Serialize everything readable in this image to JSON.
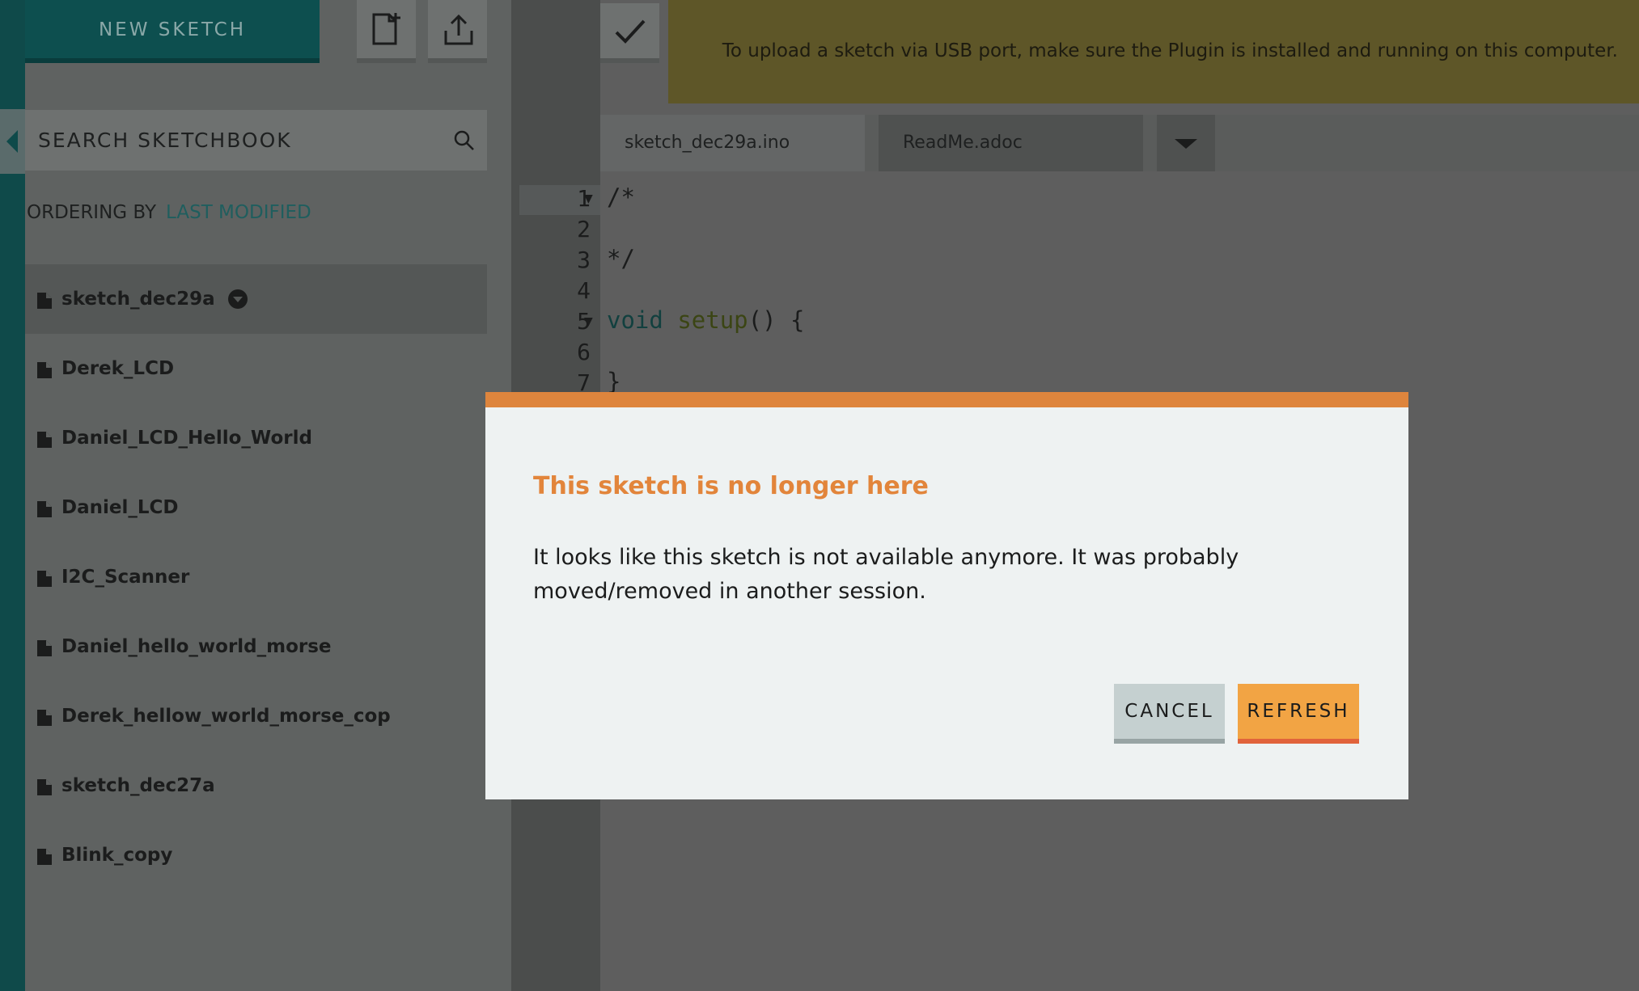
{
  "sidebar": {
    "new_sketch_label": "NEW SKETCH",
    "search_placeholder": "SEARCH SKETCHBOOK",
    "ordering_label": "ORDERING BY",
    "ordering_value": "LAST MODIFIED",
    "sketches": [
      {
        "name": "sketch_dec29a",
        "active": true
      },
      {
        "name": "Derek_LCD"
      },
      {
        "name": "Daniel_LCD_Hello_World"
      },
      {
        "name": "Daniel_LCD"
      },
      {
        "name": "I2C_Scanner"
      },
      {
        "name": "Daniel_hello_world_morse"
      },
      {
        "name": "Derek_hellow_world_morse_cop"
      },
      {
        "name": "sketch_dec27a"
      },
      {
        "name": "Blink_copy"
      }
    ]
  },
  "banner": {
    "text": "To upload a sketch via USB port, make sure the Plugin is installed and running on this computer."
  },
  "editor": {
    "tabs": [
      {
        "label": "sketch_dec29a.ino"
      },
      {
        "label": "ReadMe.adoc"
      }
    ],
    "line_numbers": [
      "1",
      "2",
      "3",
      "4",
      "5",
      "6",
      "7"
    ]
  },
  "modal": {
    "title": "This sketch is no longer here",
    "body": "It looks like this sketch is not available anymore. It was probably moved/removed in another session.",
    "cancel_label": "CANCEL",
    "refresh_label": "REFRESH"
  },
  "colors": {
    "accent": "#e2853b",
    "brand_teal": "#0d4f4f",
    "refresh": "#f2a444"
  }
}
